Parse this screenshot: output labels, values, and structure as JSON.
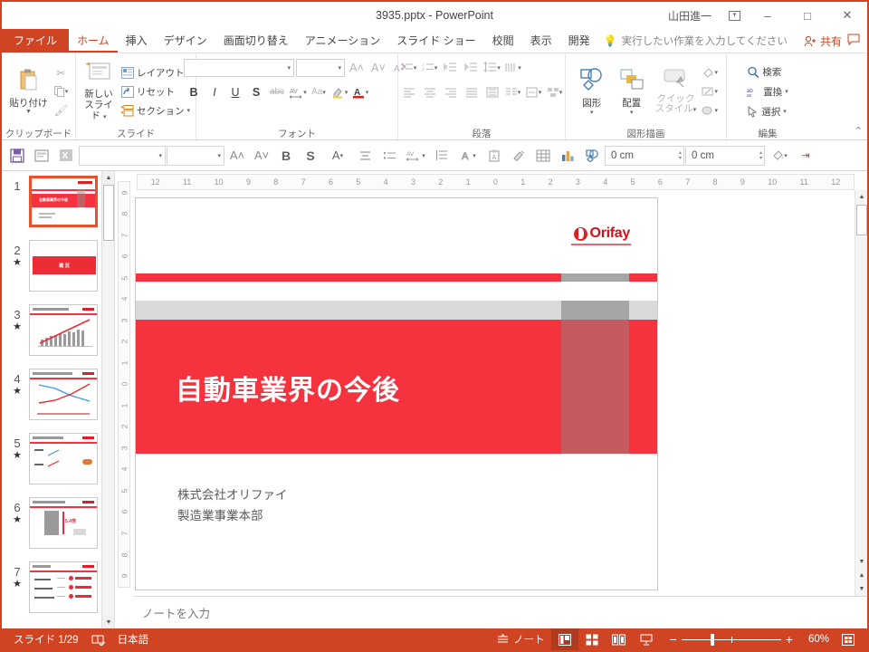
{
  "window": {
    "title": "3935.pptx  -  PowerPoint",
    "user_name": "山田進一",
    "account_icon": "account-switch-icon",
    "minimize": "–",
    "maximize": "□",
    "close": "✕"
  },
  "tabs": [
    {
      "label": "ファイル",
      "name": "tab-file"
    },
    {
      "label": "ホーム",
      "name": "tab-home"
    },
    {
      "label": "挿入",
      "name": "tab-insert"
    },
    {
      "label": "デザイン",
      "name": "tab-design"
    },
    {
      "label": "画面切り替え",
      "name": "tab-transitions"
    },
    {
      "label": "アニメーション",
      "name": "tab-animations"
    },
    {
      "label": "スライド ショー",
      "name": "tab-slideshow"
    },
    {
      "label": "校閲",
      "name": "tab-review"
    },
    {
      "label": "表示",
      "name": "tab-view"
    },
    {
      "label": "開発",
      "name": "tab-developer"
    }
  ],
  "tellme": {
    "placeholder": "実行したい作業を入力してください",
    "icon": "lightbulb-icon"
  },
  "share": {
    "label": "共有",
    "icon": "person-add-icon"
  },
  "comments": {
    "icon": "comment-icon"
  },
  "ribbon": {
    "groups": [
      {
        "label": "クリップボード",
        "name": "group-clipboard"
      },
      {
        "label": "スライド",
        "name": "group-slides"
      },
      {
        "label": "フォント",
        "name": "group-font"
      },
      {
        "label": "段落",
        "name": "group-paragraph"
      },
      {
        "label": "図形描画",
        "name": "group-drawing"
      },
      {
        "label": "編集",
        "name": "group-editing"
      }
    ],
    "clipboard": {
      "paste": "貼り付け",
      "cut_icon": "scissors-icon",
      "copy_icon": "copy-icon",
      "format_painter_icon": "format-painter-icon"
    },
    "slides": {
      "new_slide": "新しい",
      "new_slide2": "スライド",
      "layout": "レイアウト",
      "reset": "リセット",
      "section": "セクション"
    },
    "font": {
      "font_name": "",
      "font_size": "",
      "grow_icon": "grow-font-icon",
      "shrink_icon": "shrink-font-icon",
      "clear_icon": "clear-formatting-icon",
      "bold": "B",
      "italic": "I",
      "underline": "U",
      "shadow": "S",
      "strike": "abc",
      "spacing_icon": "character-spacing-icon",
      "case": "Aa",
      "highlight_icon": "text-highlight-icon",
      "color": "A"
    },
    "paragraph": {
      "bullets_icon": "bullets-icon",
      "numbering_icon": "numbering-icon",
      "dec_indent_icon": "decrease-indent-icon",
      "inc_indent_icon": "increase-indent-icon",
      "line_spacing_icon": "line-spacing-icon",
      "align_left_icon": "align-left-icon",
      "align_center_icon": "align-center-icon",
      "align_right_icon": "align-right-icon",
      "justify_icon": "justify-icon",
      "columns_icon": "columns-icon",
      "text_direction_icon": "text-direction-icon",
      "align_text_icon": "align-text-icon",
      "smartart_icon": "smartart-icon"
    },
    "drawing": {
      "shapes": "図形",
      "arrange": "配置",
      "quick_styles": "クイック",
      "quick_styles2": "スタイル",
      "fill_icon": "shape-fill-icon",
      "outline_icon": "shape-outline-icon",
      "effects_icon": "shape-effects-icon"
    },
    "editing": {
      "find": "検索",
      "replace": "置換",
      "select": "選択",
      "find_icon": "search-icon",
      "replace_icon": "replace-icon",
      "select_icon": "cursor-select-icon"
    },
    "collapse_icon": "collapse-ribbon-icon"
  },
  "addin_toolbar": {
    "buttons": [
      {
        "name": "save-icon",
        "glyph": "💾"
      },
      {
        "name": "slide-icon",
        "glyph": "▣"
      },
      {
        "name": "excel-icon",
        "glyph": "✕"
      }
    ],
    "font_name": "",
    "font_size": "",
    "grow": "A",
    "shrink": "A",
    "bold": "B",
    "shadow": "S",
    "font_color": "A",
    "align_icon": "align-icon",
    "bullets_icon": "bullets-icon",
    "spacing_icon": "character-spacing-icon",
    "line_spacing_icon": "paragraph-spacing-icon",
    "wordart_icon": "wordart-icon",
    "paste_special_icon": "paste-special-icon",
    "brush_icon": "format-painter-icon",
    "table_icon": "table-icon",
    "chart_icon": "chart-icon",
    "shape_icon": "shape-icon",
    "width_value": "0 cm",
    "height_value": "0 cm",
    "fill_icon": "fill-color-icon",
    "more_icon": "more-icon"
  },
  "thumbnails": [
    {
      "number": "1",
      "starred": false,
      "selected": true
    },
    {
      "number": "2",
      "starred": true,
      "selected": false
    },
    {
      "number": "3",
      "starred": true,
      "selected": false
    },
    {
      "number": "4",
      "starred": true,
      "selected": false
    },
    {
      "number": "5",
      "starred": true,
      "selected": false
    },
    {
      "number": "6",
      "starred": true,
      "selected": false
    },
    {
      "number": "7",
      "starred": true,
      "selected": false
    }
  ],
  "thumb_star_glyph": "★",
  "rulers": {
    "horizontal": [
      "12",
      "11",
      "10",
      "9",
      "8",
      "7",
      "6",
      "5",
      "4",
      "3",
      "2",
      "1",
      "0",
      "1",
      "2",
      "3",
      "4",
      "5",
      "6",
      "7",
      "8",
      "9",
      "10",
      "11",
      "12"
    ],
    "vertical": [
      "9",
      "8",
      "7",
      "6",
      "5",
      "4",
      "3",
      "2",
      "1",
      "0",
      "1",
      "2",
      "3",
      "4",
      "5",
      "6",
      "7",
      "8",
      "9"
    ]
  },
  "slide": {
    "logo_text": "Orifay",
    "title": "自動車業界の今後",
    "subtitle_line1": "株式会社オリファイ",
    "subtitle_line2": "製造業事業本部",
    "accent_red": "#f5333f",
    "accent_gray": "#a6a6a6",
    "logo_red": "#d3101a"
  },
  "notes": {
    "placeholder": "ノートを入力"
  },
  "status": {
    "slide_counter": "スライド 1/29",
    "proofing_icon": "spellcheck-icon",
    "language": "日本語",
    "notes_label": "ノート",
    "notes_icon": "notes-icon",
    "view_normal_icon": "view-normal-icon",
    "view_sorter_icon": "view-sorter-icon",
    "view_reading_icon": "view-reading-icon",
    "view_slideshow_icon": "view-slideshow-icon",
    "zoom_out": "−",
    "zoom_in": "+",
    "zoom_level": "60%",
    "fit_icon": "fit-slide-icon"
  }
}
